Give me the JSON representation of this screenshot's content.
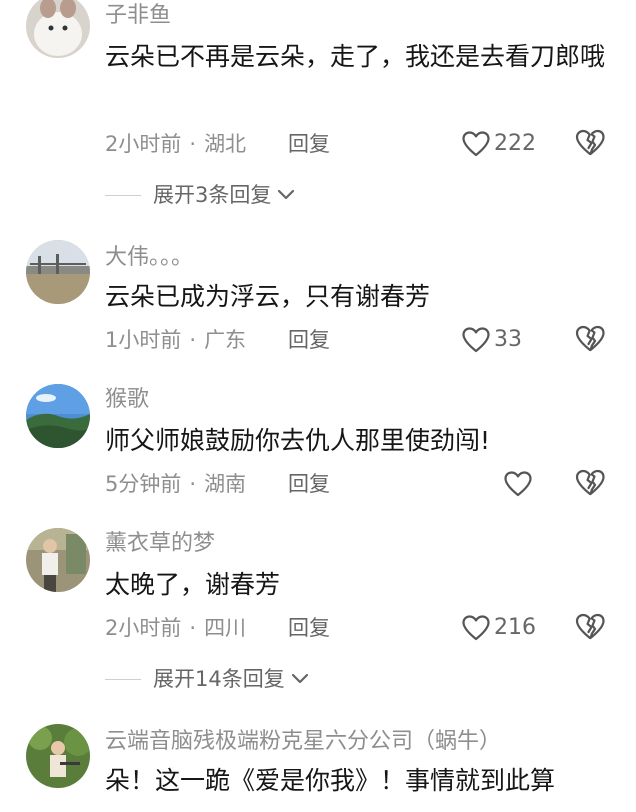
{
  "comments": [
    {
      "username": "子非鱼",
      "content": "云朵已不再是云朵，走了，我还是去看刀郎哦",
      "time": "2小时前",
      "location": "湖北",
      "reply": "回复",
      "likes": "222"
    },
    {
      "username": "大伟。。。",
      "content": "云朵已成为浮云，只有谢春芳",
      "time": "1小时前",
      "location": "广东",
      "reply": "回复",
      "likes": "33"
    },
    {
      "username": "猴歌",
      "content": "师父师娘鼓励你去仇人那里使劲闯!",
      "time": "5分钟前",
      "location": "湖南",
      "reply": "回复",
      "likes": ""
    },
    {
      "username": "薰衣草的梦",
      "content": "太晚了，谢春芳",
      "time": "2小时前",
      "location": "四川",
      "reply": "回复",
      "likes": "216"
    },
    {
      "username": "云端音脑残极端粉克星六分公司（蜗牛）",
      "content": "朵！这一跪《爱是你我》！事情就到此算"
    }
  ],
  "expand_replies": [
    {
      "label": "展开3条回复"
    },
    {
      "label": "展开14条回复"
    }
  ],
  "meta_separator": "·",
  "icons": {
    "like": "heart-outline-icon",
    "dislike": "broken-heart-icon",
    "expand": "chevron-down-icon"
  },
  "colors": {
    "username": "#8e8e8e",
    "content": "#161616",
    "meta": "#8e8e8e",
    "action": "#666666"
  }
}
